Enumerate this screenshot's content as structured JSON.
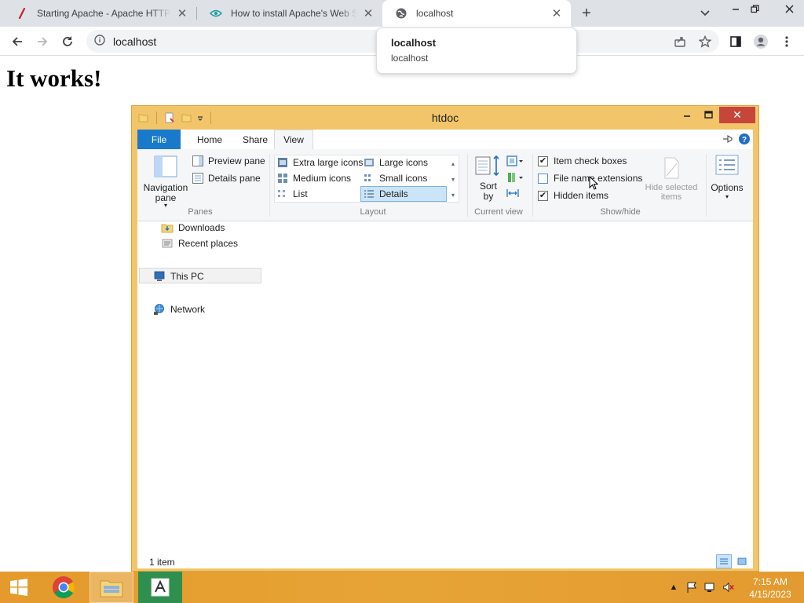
{
  "browser": {
    "tabs": [
      {
        "title": "Starting Apache - Apache HTTP Server",
        "favicon": "apache-feather-icon",
        "active": false
      },
      {
        "title": "How to install Apache's Web Server",
        "favicon": "eye-icon",
        "active": false
      },
      {
        "title": "localhost",
        "favicon": "globe-icon",
        "active": true
      }
    ],
    "url": "localhost",
    "hover_card": {
      "title": "localhost",
      "subtitle": "localhost"
    }
  },
  "page": {
    "heading": "It works!"
  },
  "explorer": {
    "title": "htdoc",
    "ribbon_tabs": [
      "File",
      "Home",
      "Share",
      "View"
    ],
    "active_tab": "View",
    "panes": {
      "navigation_pane": "Navigation pane",
      "preview_pane": "Preview pane",
      "details_pane": "Details pane",
      "group_label": "Panes"
    },
    "layout": {
      "options": [
        "Extra large icons",
        "Large icons",
        "Medium icons",
        "Small icons",
        "List",
        "Details"
      ],
      "selected": "Details",
      "group_label": "Layout"
    },
    "current_view": {
      "sort_by": "Sort by",
      "group_label": "Current view"
    },
    "show_hide": {
      "item_check_boxes": {
        "label": "Item check boxes",
        "checked": true
      },
      "file_name_extensions": {
        "label": "File name extensions",
        "checked": false
      },
      "hidden_items": {
        "label": "Hidden items",
        "checked": true
      },
      "hide_selected_items": "Hide selected items",
      "group_label": "Show/hide"
    },
    "options_label": "Options",
    "navigation": [
      {
        "label": "Downloads",
        "icon": "downloads-folder-icon"
      },
      {
        "label": "Recent places",
        "icon": "recent-places-icon"
      },
      {
        "label": "This PC",
        "icon": "this-pc-icon"
      },
      {
        "label": "Network",
        "icon": "network-icon"
      }
    ],
    "status": "1 item"
  },
  "taskbar": {
    "clock": {
      "time": "7:15 AM",
      "date": "4/15/2023"
    }
  },
  "colors": {
    "explorer_frame": "#f2c56a",
    "file_tab": "#1979ca",
    "close_red": "#c7463b",
    "taskbar": "#e49a2c"
  }
}
